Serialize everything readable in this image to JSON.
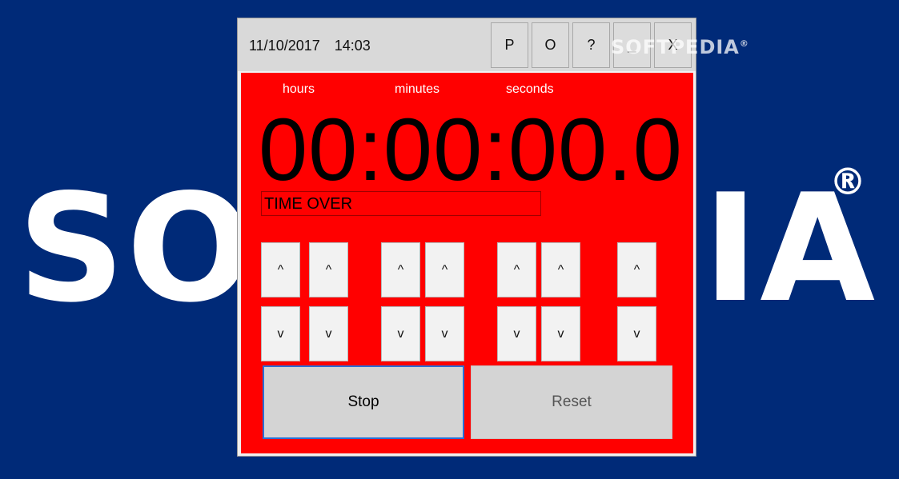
{
  "background": {
    "logo_left": "SO",
    "logo_right": "IA",
    "registered": "®",
    "color": "#002a78"
  },
  "window": {
    "date": "11/10/2017",
    "time": "14:03",
    "buttons": {
      "p": "P",
      "o": "O",
      "help": "?",
      "minimize": "_",
      "close": "X"
    },
    "watermark": "SOFTPEDIA",
    "watermark_reg": "®"
  },
  "timer": {
    "labels": {
      "hours": "hours",
      "minutes": "minutes",
      "seconds": "seconds"
    },
    "display": "00:00:00.0",
    "status": "TIME OVER",
    "up": "^",
    "down": "v",
    "panel_color": "#ff0000"
  },
  "actions": {
    "stop": "Stop",
    "reset": "Reset"
  }
}
